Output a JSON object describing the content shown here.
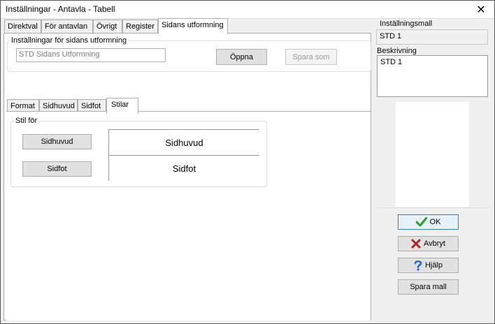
{
  "window": {
    "title": "Inställningar - Antavla - Tabell",
    "close_glyph": "✕"
  },
  "tabs": [
    {
      "label": "Direktval"
    },
    {
      "label": "För antavlan"
    },
    {
      "label": "Övrigt"
    },
    {
      "label": "Register"
    },
    {
      "label": "Sidans utformning",
      "active": true
    }
  ],
  "page_settings": {
    "group_label": "Inställningar för sidans utformning",
    "template_value": "STD Sidans Utformning",
    "open_button": "Öppna",
    "save_as_button": "Spara som"
  },
  "inner_tabs": [
    {
      "label": "Format"
    },
    {
      "label": "Sidhuvud"
    },
    {
      "label": "Sidfot"
    },
    {
      "label": "Stilar",
      "active": true
    }
  ],
  "styles": {
    "group_label": "Stil för",
    "header_button": "Sidhuvud",
    "footer_button": "Sidfot",
    "header_preview": "Sidhuvud",
    "footer_preview": "Sidfot"
  },
  "right_pane": {
    "template_label": "Inställningsmall",
    "template_value": "STD 1",
    "description_label": "Beskrivning",
    "description_value": "STD 1"
  },
  "buttons": {
    "ok": "OK",
    "cancel": "Avbryt",
    "help": "Hjälp",
    "save_template": "Spara mall"
  },
  "icons": {
    "ok": "check-icon",
    "cancel": "x-icon",
    "help": "question-icon",
    "ok_color": "#2e9a2e",
    "cancel_color": "#b02020",
    "help_color": "#1a6fd6"
  }
}
